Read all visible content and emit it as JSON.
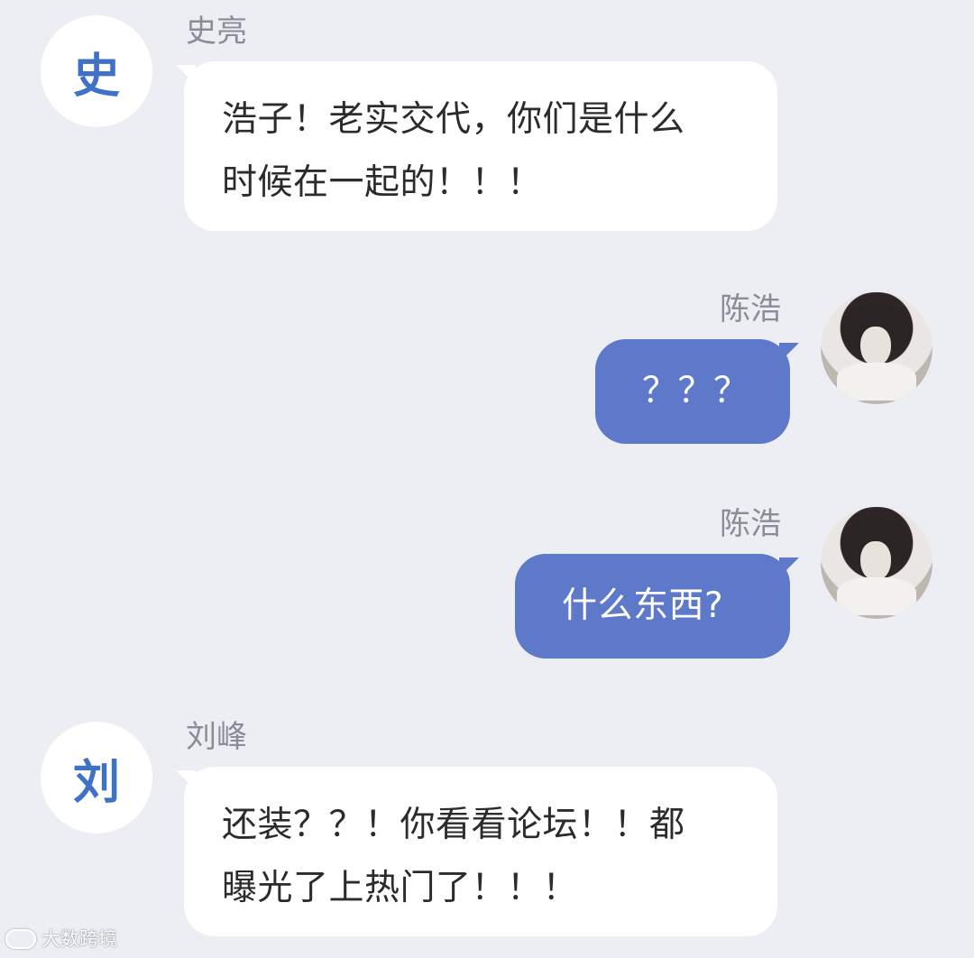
{
  "messages": [
    {
      "sender": "史亮",
      "avatar_text": "史",
      "side": "left",
      "lines": [
        "浩子！老实交代，你们是什么",
        "时候在一起的！！！"
      ]
    },
    {
      "sender": "陈浩",
      "avatar_text": "",
      "side": "right",
      "lines": [
        "？？？"
      ]
    },
    {
      "sender": "陈浩",
      "avatar_text": "",
      "side": "right",
      "lines": [
        "什么东西?"
      ]
    },
    {
      "sender": "刘峰",
      "avatar_text": "刘",
      "side": "left",
      "lines": [
        "还装？？！你看看论坛！！都",
        "曝光了上热门了！！！"
      ]
    }
  ],
  "watermark": {
    "text": "大数跨境"
  },
  "colors": {
    "background": "#ededf4",
    "bubble_self": "#5e79c9",
    "bubble_other": "#ffffff",
    "avatar_text": "#3f72c5",
    "name_text": "#8a8d96"
  }
}
